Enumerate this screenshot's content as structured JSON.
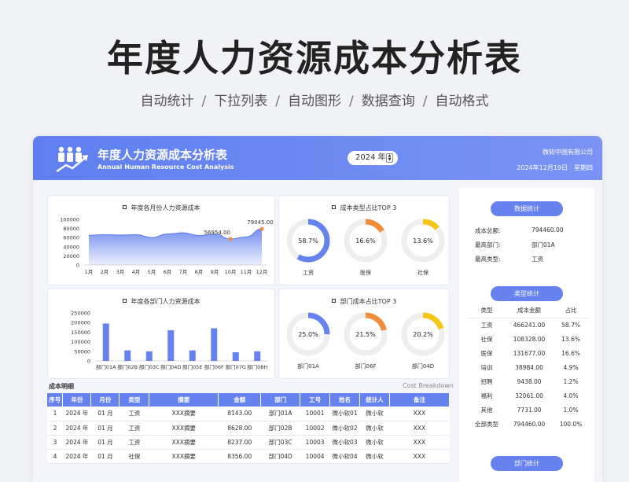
{
  "hero": {
    "title": "年度人力资源成本分析表",
    "features": [
      "自动统计",
      "下拉列表",
      "自动图形",
      "数据查询",
      "自动格式"
    ],
    "separator": "/"
  },
  "header": {
    "title": "年度人力资源成本分析表",
    "subtitle_en": "Annual Human Resource Cost Analysis",
    "year_value": "2024 年",
    "company": "微软中国有限公司",
    "date": "2024年12月19日",
    "weekday": "星期四"
  },
  "colors": {
    "accent": "#6582ef",
    "orange": "#f08c3a",
    "yellow": "#f5c518",
    "ring_bg": "#eeeeee"
  },
  "monthly_chart": {
    "title": "年度各月份人力资源成本",
    "chart_data": {
      "type": "area",
      "categories": [
        "1月",
        "2月",
        "3月",
        "4月",
        "5月",
        "6月",
        "7月",
        "8月",
        "9月",
        "10月",
        "11月",
        "12月"
      ],
      "values": [
        65000,
        66500,
        65500,
        66500,
        60000,
        68000,
        70500,
        64500,
        68000,
        56954,
        61500,
        79045
      ],
      "ylim": [
        0,
        100000
      ],
      "yticks": [
        "100000",
        "80000",
        "60000",
        "40000",
        "20000",
        "0"
      ],
      "annotations": [
        {
          "label": "56954.00",
          "index": 9
        },
        {
          "label": "79045.00",
          "index": 11
        }
      ]
    }
  },
  "type_top3": {
    "title": "成本类型占比TOP 3",
    "items": [
      {
        "label": "工资",
        "pct_text": "58.7%",
        "value": 0.587,
        "color": "#6582ef"
      },
      {
        "label": "医保",
        "pct_text": "16.6%",
        "value": 0.166,
        "color": "#f08c3a"
      },
      {
        "label": "社保",
        "pct_text": "13.6%",
        "value": 0.136,
        "color": "#f5c518"
      }
    ]
  },
  "dept_chart": {
    "title": "年度各部门人力资源成本",
    "chart_data": {
      "type": "bar",
      "categories": [
        "部门01A",
        "部门02B",
        "部门03C",
        "部门04D",
        "部门05E",
        "部门06F",
        "部门07G",
        "部门08H"
      ],
      "values": [
        195000,
        55000,
        50000,
        160000,
        55000,
        170000,
        45000,
        50000
      ],
      "ylim": [
        0,
        250000
      ],
      "yticks": [
        "250000",
        "200000",
        "150000",
        "100000",
        "50000",
        "0"
      ]
    }
  },
  "dept_top3": {
    "title": "部门成本占比TOP 3",
    "items": [
      {
        "label": "部门01A",
        "pct_text": "25.0%",
        "value": 0.25,
        "color": "#6582ef"
      },
      {
        "label": "部门06F",
        "pct_text": "21.5%",
        "value": 0.215,
        "color": "#f08c3a"
      },
      {
        "label": "部门04D",
        "pct_text": "20.2%",
        "value": 0.202,
        "color": "#f5c518"
      }
    ]
  },
  "detail": {
    "title": "成本明细",
    "title_en": "Cost Breakdown",
    "columns": [
      "序号",
      "年份",
      "月份",
      "类型",
      "摘要",
      "金额",
      "部门",
      "工号",
      "姓名",
      "统计人",
      "备注"
    ],
    "rows": [
      [
        "1",
        "2024 年",
        "01 月",
        "工资",
        "XXX摘要",
        "8143.00",
        "部门01A",
        "10001",
        "微小软01",
        "微小软",
        "XXX"
      ],
      [
        "2",
        "2024 年",
        "01 月",
        "工资",
        "XXX摘要",
        "8628.00",
        "部门02B",
        "10002",
        "微小软02",
        "微小软",
        "XXX"
      ],
      [
        "3",
        "2024 年",
        "01 月",
        "工资",
        "XXX摘要",
        "8237.00",
        "部门03C",
        "10003",
        "微小软03",
        "微小软",
        "XXX"
      ],
      [
        "4",
        "2024 年",
        "01 月",
        "社保",
        "XXX摘要",
        "8356.00",
        "部门04D",
        "10004",
        "微小软04",
        "微小软",
        "XXX"
      ]
    ]
  },
  "stats": {
    "title": "数据统计",
    "rows": [
      {
        "k": "成本总额:",
        "v": "794460.00"
      },
      {
        "k": "最高部门:",
        "v": "部门01A"
      },
      {
        "k": "最高类型:",
        "v": "工资"
      }
    ]
  },
  "type_stats": {
    "title": "类型统计",
    "columns": [
      "类型",
      "成本金额",
      "占比"
    ],
    "rows": [
      [
        "工资",
        "466241.00",
        "58.7%"
      ],
      [
        "社保",
        "108328.00",
        "13.6%"
      ],
      [
        "医保",
        "131677.00",
        "16.6%"
      ],
      [
        "培训",
        "38984.00",
        "4.9%"
      ],
      [
        "招聘",
        "9438.00",
        "1.2%"
      ],
      [
        "福利",
        "32061.00",
        "4.0%"
      ],
      [
        "其他",
        "7731.00",
        "1.0%"
      ],
      [
        "全部类型",
        "794460.00",
        "100.0%"
      ]
    ]
  },
  "dept_stats": {
    "title": "部门统计"
  }
}
